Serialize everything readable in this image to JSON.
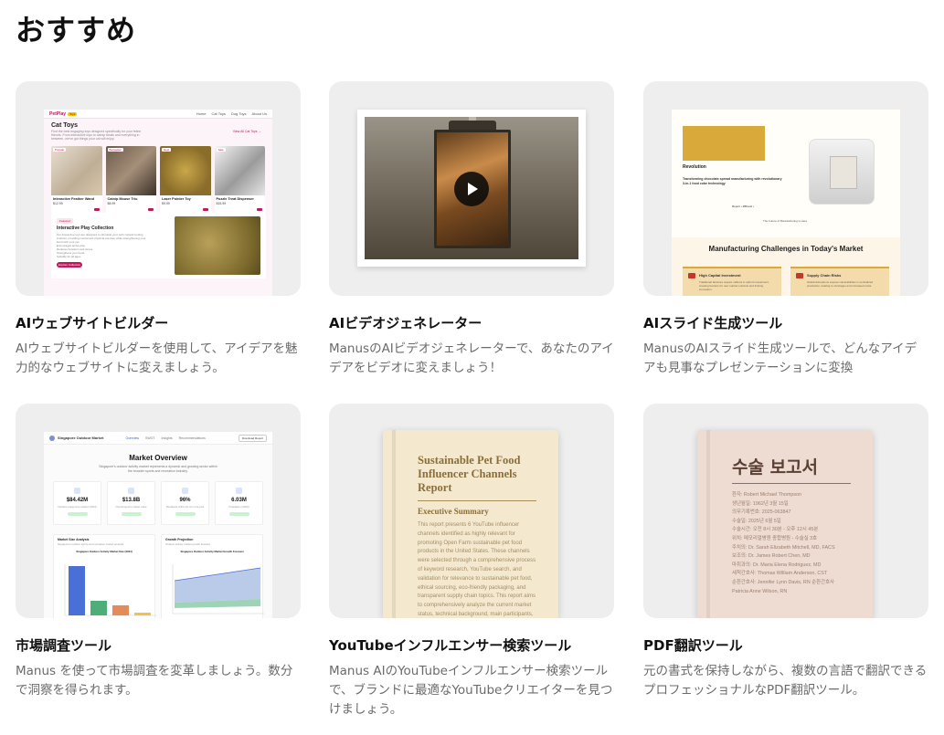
{
  "page": {
    "title": "おすすめ"
  },
  "cards": [
    {
      "title": "AIウェブサイトビルダー",
      "desc": "AIウェブサイトビルダーを使用して、アイデアを魅力的なウェブサイトに変えましょう。",
      "preview": {
        "logo": "PetPlay",
        "logo_badge": "Toys",
        "nav": [
          "Home",
          "Cat Toys",
          "Dog Toys",
          "About Us"
        ],
        "heading": "Cat Toys",
        "subtitle": "Find the best engaging toys designed specifically for your feline friends. From interactive toys to catnip treats and everything in between, we've got things your cat will enjoy.",
        "view_all": "View All Cat Toys →",
        "products": [
          {
            "tag": "Popular",
            "name": "Interactive Feather Wand",
            "price": "$12.99"
          },
          {
            "tag": "Bestseller",
            "name": "Catnip Mouse Trio",
            "price": "$8.99"
          },
          {
            "tag": "New",
            "name": "Laser Pointer Toy",
            "price": "$9.99"
          },
          {
            "tag": "Sale",
            "name": "Puzzle Treat Dispenser",
            "price": "$15.99"
          }
        ],
        "feature_tag": "Featured",
        "feature_title": "Interactive Play Collection",
        "feature_text": "Our interactive toys are designed to stimulate your cat's natural hunting instincts, providing mental and physical exercise while strengthening your bond with your pet.",
        "feature_list": [
          "Encourages active play",
          "Reduces boredom and stress",
          "Strengthens your bond",
          "Suitable for all ages"
        ],
        "feature_button": "Explore Collection"
      }
    },
    {
      "title": "AIビデオジェネレーター",
      "desc": "ManusのAIビデオジェネレーターで、あなたのアイデアをビデオに変えましょう！"
    },
    {
      "title": "AIスライド生成ツール",
      "desc": "ManusのAIスライド生成ツールで、どんなアイデアも見事なプレゼンテーションに変換",
      "preview": {
        "revolution": "Revolution",
        "tagline": "Transforming chocolate spread manufacturing with revolutionary 3-in-1 food cube technology",
        "mark": "Report • #iBrand •",
        "future": "The Future of Manufacturing is Here",
        "heading": "Manufacturing Challenges in Today's Market",
        "boxes": [
          {
            "title": "High Capital Investment",
            "text": "Traditional factories require millions in upfront investment, creating barriers for new market entrants and limiting innovation."
          },
          {
            "title": "Supply Chain Risks",
            "text": "Global disruptions expose vulnerabilities in centralized production, leading to shortages and increased costs."
          }
        ]
      }
    },
    {
      "title": "市場調査ツール",
      "desc": "Manus を使って市場調査を変革しましょう。数分で洞察を得られます。",
      "preview": {
        "brand": "Singapore Outdoor Market",
        "nav": [
          "Overview",
          "SWOT",
          "Insights",
          "Recommendations"
        ],
        "download": "Download Report",
        "heading": "Market Overview",
        "subtitle": "Singapore's outdoor activity market represents a dynamic and growing sector within the broader sports and recreation industry.",
        "stats": [
          {
            "value": "$84.42M",
            "label": "Outdoor equipment market (2024)"
          },
          {
            "value": "$13.8B",
            "label": "Overall sports market value"
          },
          {
            "value": "96%",
            "label": "Residents within 10 min of a park"
          },
          {
            "value": "6.03M",
            "label": "Population (2024)"
          }
        ],
        "chart1_title": "Market Size Analysis",
        "chart1_sub": "Singapore's outdoor sports and recreation market analysis",
        "chart1_inner": "Singapore Outdoor Activity Market Size (2024)",
        "chart2_title": "Growth Projection",
        "chart2_sub": "Outdoor activity market growth forecast",
        "chart2_inner": "Singapore Outdoor Activity Market Growth Forecast"
      }
    },
    {
      "title": "YouTubeインフルエンサー検索ツール",
      "desc": "Manus AIのYouTubeインフルエンサー検索ツールで、ブランドに最適なYouTubeクリエイターを見つけましょう。",
      "preview": {
        "book_title": "Sustainable Pet Food Influencer Channels Report",
        "section": "Executive Summary",
        "body": "This report presents 6 YouTube influencer channels identified as highly relevant for promoting Open Farm sustainable pet food products in the United States. These channels were selected through a comprehensive process of keyword research, YouTube search, and validation for relevance to sustainable pet food, ethical sourcing, eco-friendly packaging, and transparent supply chain topics. This report aims to comprehensively analyze the current market status, technical background, main participants, and application"
      }
    },
    {
      "title": "PDF翻訳ツール",
      "desc": "元の書式を保持しながら、複数の言語で翻訳できるプロフェッショナルなPDF翻訳ツール。",
      "preview": {
        "book_title": "수술 보고서",
        "lines": [
          "환자: Robert Michael Thompson",
          "생년월일: 1962년 3월 15일",
          "의무기록번호: 2025-063847",
          "수술일: 2025년 6월 5일",
          "수술시간: 오전 8시 30분 - 오후 12시 45분",
          "위치: 메모리얼병원 종합병원 - 수술실 3호",
          "주치의: Dr. Sarah Elizabeth Mitchell, MD, FACS",
          "보조의: Dr. James Robert Chen, MD",
          "마취과의: Dr. Maria Elena Rodriguez, MD",
          "세척간호사: Thomas William Anderson, CST",
          "순환간호사: Jennifer Lynn Davis, RN 순환간호사",
          "Patricia Anne Wilson, RN"
        ]
      }
    }
  ],
  "colors": {
    "card_bg": "#eeeeee",
    "title": "#111111",
    "desc": "#6b6b6b",
    "brand_pink": "#c2185b",
    "slide_gold": "#d9a93a",
    "chart_blue": "#4a6fd6"
  }
}
